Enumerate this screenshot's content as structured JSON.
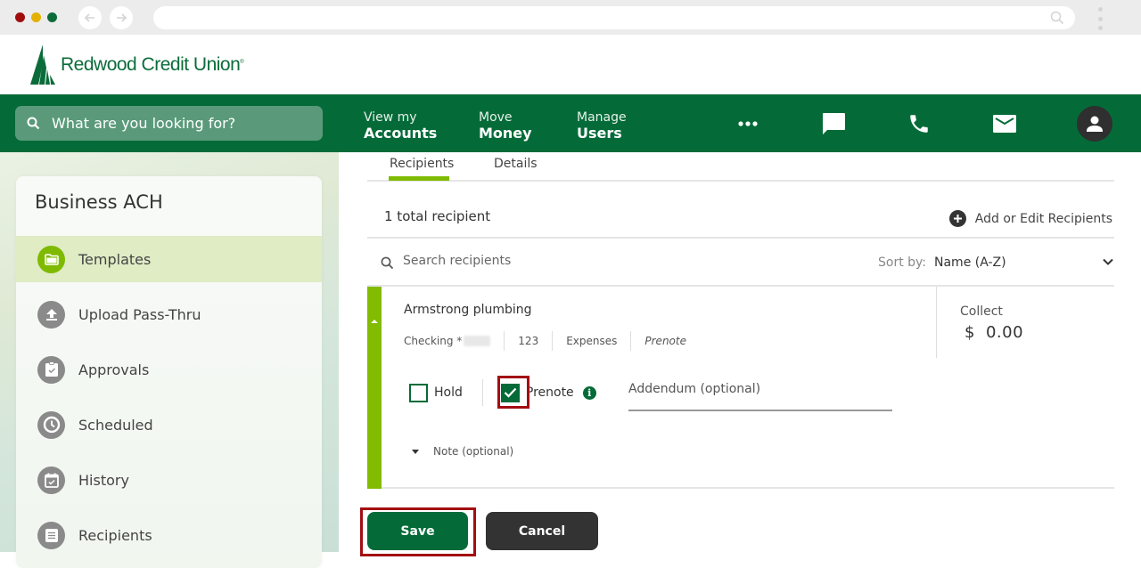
{
  "browser": {
    "back_icon": "arrow-left-icon",
    "forward_icon": "arrow-right-icon",
    "url": "",
    "menu_icon": "kebab-icon"
  },
  "brand": {
    "name": "Redwood Credit Union",
    "mark": "®",
    "color": "#0b6c3a"
  },
  "topnav": {
    "search_placeholder": "What are you looking for?",
    "items": [
      {
        "small": "View my",
        "big": "Accounts"
      },
      {
        "small": "Move",
        "big": "Money"
      },
      {
        "small": "Manage",
        "big": "Users"
      }
    ],
    "icons": [
      "more-icon",
      "chat-icon",
      "phone-icon",
      "mail-icon",
      "account-icon"
    ],
    "color": "#046b38"
  },
  "sidebar": {
    "title": "Business ACH",
    "items": [
      {
        "label": "Templates",
        "icon": "folder-icon",
        "active": true
      },
      {
        "label": "Upload Pass-Thru",
        "icon": "upload-icon",
        "active": false
      },
      {
        "label": "Approvals",
        "icon": "clipboard-check-icon",
        "active": false
      },
      {
        "label": "Scheduled",
        "icon": "clock-icon",
        "active": false
      },
      {
        "label": "History",
        "icon": "calendar-check-icon",
        "active": false
      },
      {
        "label": "Recipients",
        "icon": "list-icon",
        "active": false
      }
    ]
  },
  "main": {
    "tabs": [
      {
        "label": "Recipients",
        "active": true
      },
      {
        "label": "Details",
        "active": false
      }
    ],
    "count_text": "1 total recipient",
    "add_edit_label": "Add or Edit Recipients",
    "search_placeholder": "Search recipients",
    "sort_label": "Sort by:",
    "sort_value": "Name (A-Z)",
    "recipient": {
      "name": "Armstrong plumbing",
      "account": "Checking *",
      "routing_suffix": "123",
      "category": "Expenses",
      "type": "Prenote",
      "collect_label": "Collect",
      "currency": "$",
      "amount": "0.00",
      "hold_label": "Hold",
      "hold_checked": false,
      "prenote_label": "Prenote",
      "prenote_checked": true,
      "addendum_placeholder": "Addendum (optional)",
      "note_label": "Note (optional)"
    },
    "save_label": "Save",
    "cancel_label": "Cancel"
  },
  "colors": {
    "accent_green": "#7fba00",
    "highlight_red": "#a30d12",
    "dark_button": "#333333"
  }
}
